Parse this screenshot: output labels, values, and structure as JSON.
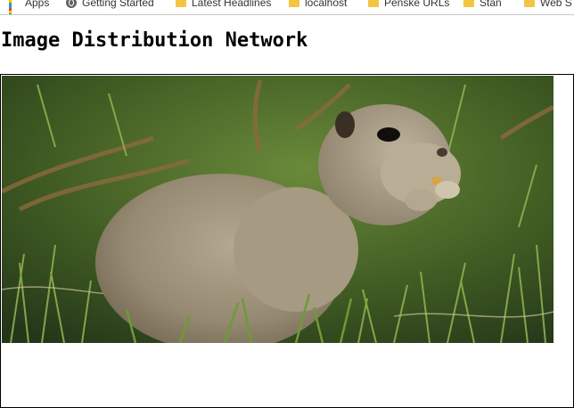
{
  "bookmarks": [
    {
      "label": "Apps",
      "icon": "apps-grid-icon"
    },
    {
      "label": "Getting Started",
      "icon": "globe-icon"
    },
    {
      "label": "Latest Headlines",
      "icon": "folder-icon"
    },
    {
      "label": "localhost",
      "icon": "folder-icon"
    },
    {
      "label": "Penske URLs",
      "icon": "folder-icon"
    },
    {
      "label": "Stan",
      "icon": "folder-icon"
    },
    {
      "label": "Web S",
      "icon": "folder-icon"
    }
  ],
  "page": {
    "title": "Image Distribution Network"
  },
  "colors": {
    "folder": "#f4c542",
    "grass_dark": "#2f4a1c",
    "grass_light": "#7fa046",
    "squirrel": "#9b8e78"
  }
}
